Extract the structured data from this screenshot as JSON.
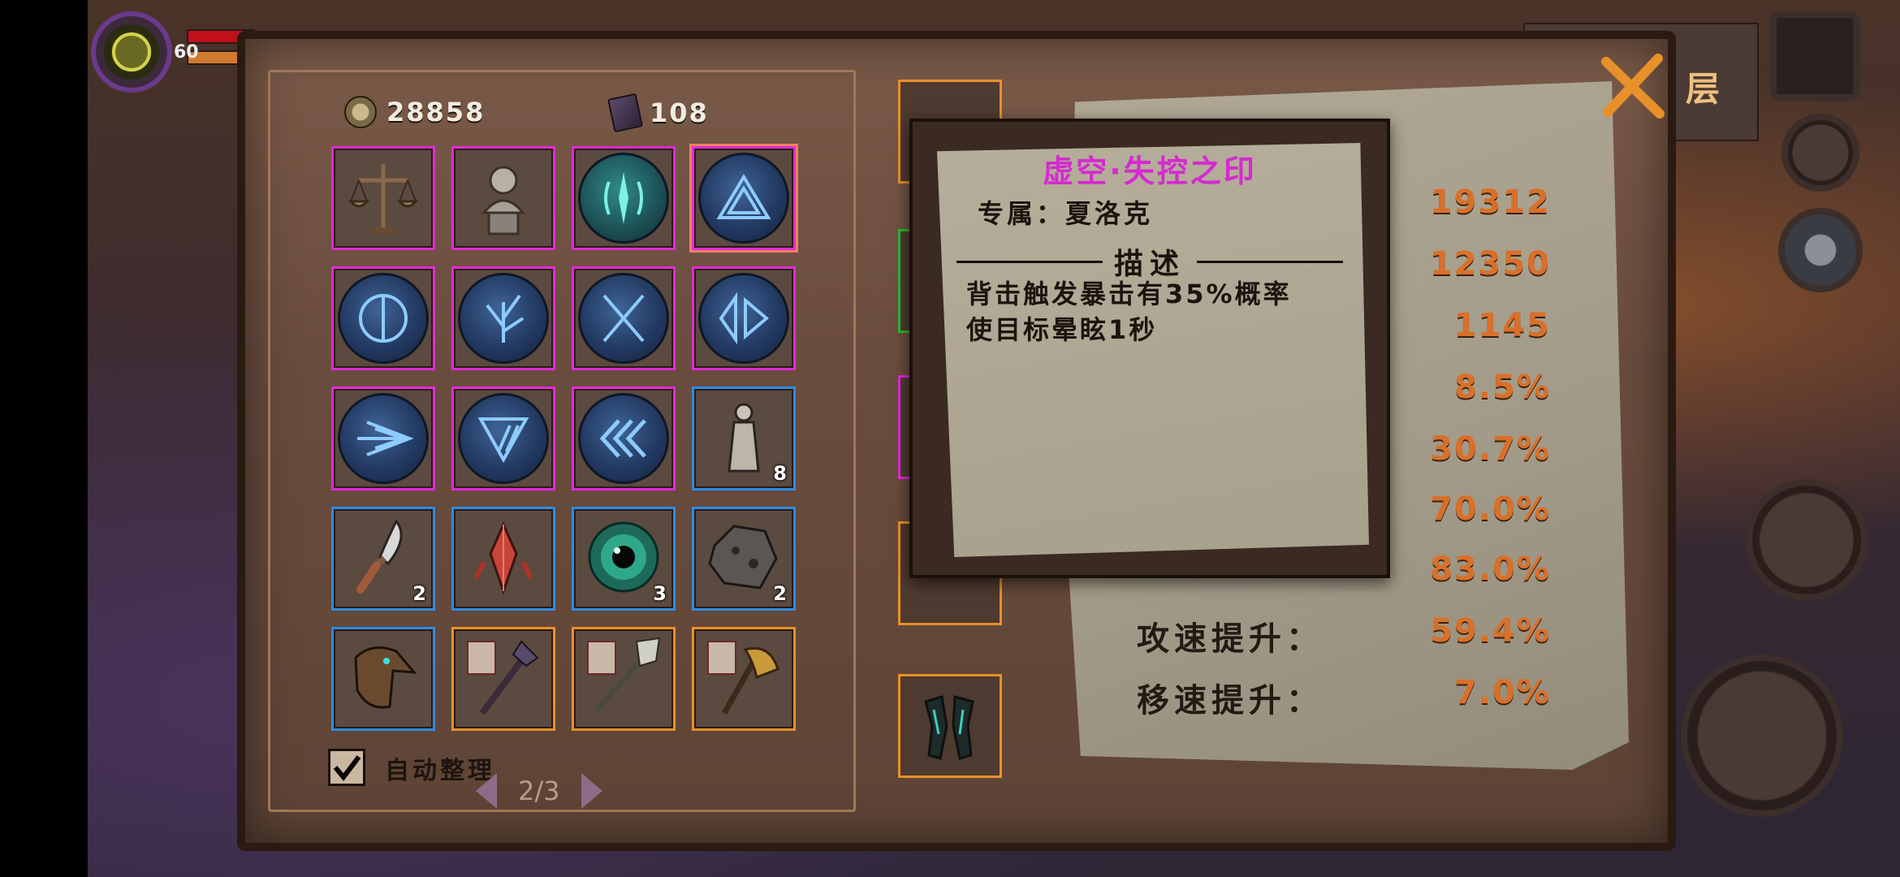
{
  "hud": {
    "level": "60"
  },
  "currency": [
    {
      "name": "coins",
      "amount": "28858",
      "icon": "coin-icon"
    },
    {
      "name": "tomes",
      "amount": "108",
      "icon": "tome-icon"
    }
  ],
  "inventory": {
    "slots": [
      {
        "icon": "scales-icon",
        "rarity": "magenta",
        "count": ""
      },
      {
        "icon": "statue-bust-icon",
        "rarity": "magenta",
        "count": ""
      },
      {
        "icon": "teal-rune-icon",
        "rarity": "magenta",
        "count": ""
      },
      {
        "icon": "triangle-rune-icon",
        "rarity": "magenta",
        "count": "",
        "selected": true
      },
      {
        "icon": "half-circle-rune-icon",
        "rarity": "magenta",
        "count": ""
      },
      {
        "icon": "branch-rune-icon",
        "rarity": "magenta",
        "count": ""
      },
      {
        "icon": "crossed-blades-rune-icon",
        "rarity": "magenta",
        "count": ""
      },
      {
        "icon": "diamond-rune-icon",
        "rarity": "magenta",
        "count": ""
      },
      {
        "icon": "burst-rune-icon",
        "rarity": "magenta",
        "count": ""
      },
      {
        "icon": "slash-triangle-rune-icon",
        "rarity": "magenta",
        "count": ""
      },
      {
        "icon": "chevrons-rune-icon",
        "rarity": "magenta",
        "count": ""
      },
      {
        "icon": "figurine-icon",
        "rarity": "blue",
        "count": "8"
      },
      {
        "icon": "dagger-icon",
        "rarity": "blue",
        "count": "2"
      },
      {
        "icon": "crystal-icon",
        "rarity": "blue",
        "count": ""
      },
      {
        "icon": "eye-orb-icon",
        "rarity": "blue",
        "count": "3"
      },
      {
        "icon": "ore-icon",
        "rarity": "blue",
        "count": "2"
      },
      {
        "icon": "bird-mask-icon",
        "rarity": "blue",
        "count": ""
      },
      {
        "icon": "staff-weapon-icon",
        "rarity": "orange",
        "count": ""
      },
      {
        "icon": "spear-weapon-icon",
        "rarity": "orange",
        "count": ""
      },
      {
        "icon": "golden-axe-icon",
        "rarity": "orange",
        "count": ""
      }
    ],
    "auto_sort_label": "自动整理",
    "auto_sort_checked": true,
    "page": "2/3"
  },
  "equipment": [
    {
      "slot": "weapon",
      "rarity": "orange"
    },
    {
      "slot": "ring",
      "rarity": "green"
    },
    {
      "slot": "amulet",
      "rarity": "magenta"
    },
    {
      "slot": "armor",
      "rarity": "orange"
    },
    {
      "slot": "gloves",
      "rarity": "orange"
    }
  ],
  "tooltip": {
    "title": "虚空·失控之印",
    "owner": "专属：夏洛克",
    "section": "描述",
    "description_lines": [
      "背击触发暴击有35%概率",
      "使目标晕眩1秒"
    ]
  },
  "stats": [
    {
      "label": "",
      "value": "19312"
    },
    {
      "label": "",
      "value": "12350"
    },
    {
      "label": "",
      "value": "1145"
    },
    {
      "label": "",
      "value": "8.5%"
    },
    {
      "label": "",
      "value": "30.7%"
    },
    {
      "label": "",
      "value": "70.0%"
    },
    {
      "label": "",
      "value": "83.0%"
    },
    {
      "label": "攻速提升：",
      "value": "59.4%"
    },
    {
      "label": "移速提升：",
      "value": "7.0%"
    }
  ],
  "floor_label": "层",
  "colors": {
    "magenta": "#e02bd8",
    "blue": "#2f8be0",
    "orange": "#e8902a",
    "green": "#2fb82f",
    "stat_value": "#d8702a",
    "tooltip_title": "#d52ad0"
  }
}
